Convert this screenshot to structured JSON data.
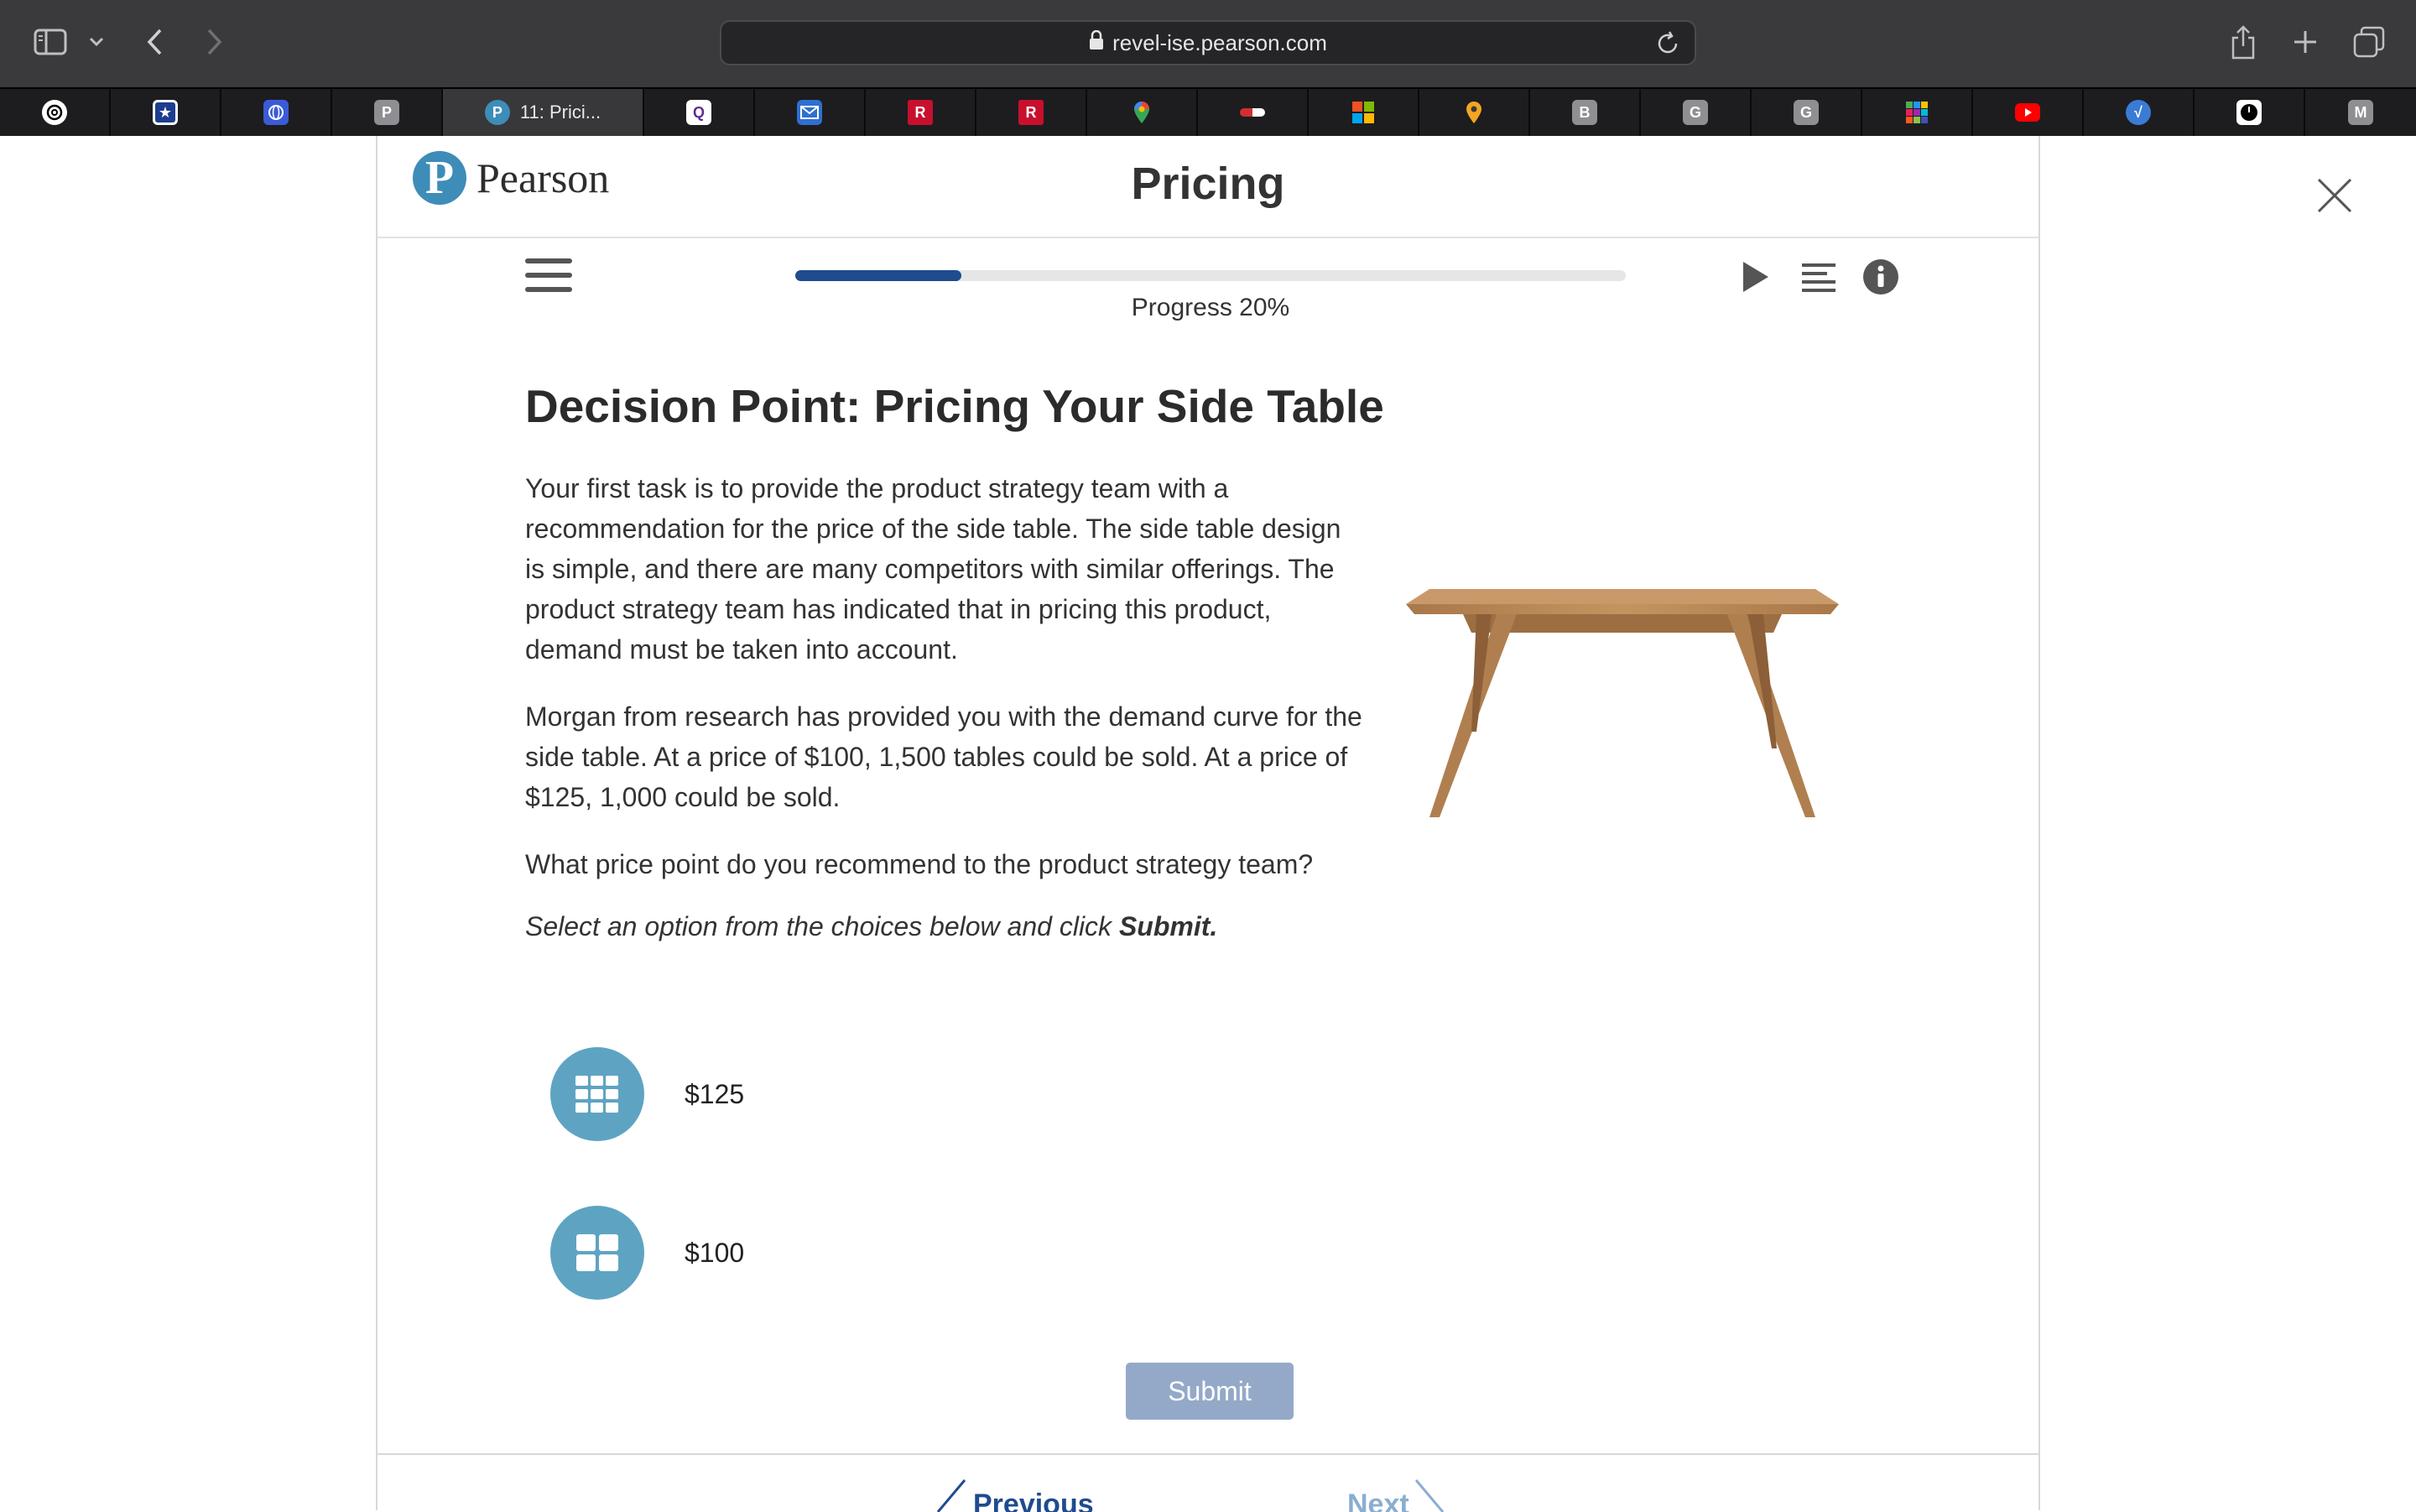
{
  "browser": {
    "url": "revel-ise.pearson.com",
    "tabs": [
      {
        "label": "",
        "icon": "openai-icon"
      },
      {
        "label": "",
        "icon": "star-badge-icon"
      },
      {
        "label": "",
        "icon": "globe-badge-icon"
      },
      {
        "label": "",
        "icon": "p-letter-icon",
        "letter": "P"
      },
      {
        "label": "11: Prici...",
        "icon": "pearson-icon",
        "active": true
      },
      {
        "label": "",
        "icon": "q-letter-icon",
        "letter": "Q"
      },
      {
        "label": "",
        "icon": "mail-icon"
      },
      {
        "label": "",
        "icon": "r-letter-icon",
        "letter": "R"
      },
      {
        "label": "",
        "icon": "r-letter-icon",
        "letter": "R"
      },
      {
        "label": "",
        "icon": "maps-pin-icon"
      },
      {
        "label": "",
        "icon": "pill-icon"
      },
      {
        "label": "",
        "icon": "microsoft-icon"
      },
      {
        "label": "",
        "icon": "location-icon"
      },
      {
        "label": "",
        "icon": "b-letter-icon",
        "letter": "B"
      },
      {
        "label": "",
        "icon": "g-letter-icon",
        "letter": "G"
      },
      {
        "label": "",
        "icon": "g-letter-icon",
        "letter": "G"
      },
      {
        "label": "",
        "icon": "grid-app-icon"
      },
      {
        "label": "",
        "icon": "youtube-icon"
      },
      {
        "label": "",
        "icon": "sqrt-icon"
      },
      {
        "label": "",
        "icon": "clock-icon"
      },
      {
        "label": "",
        "icon": "m-letter-icon",
        "letter": "M"
      }
    ]
  },
  "header": {
    "logo_text": "Pearson",
    "logo_letter": "P",
    "title": "Pricing"
  },
  "progress": {
    "value_percent": 20,
    "label": "Progress 20%"
  },
  "content": {
    "heading": "Decision Point: Pricing Your Side Table",
    "para1": "Your first task is to provide the product strategy team with a recommendation for the price of the side table. The side table design is simple, and there are many competitors with similar offerings. The product strategy team has indicated that in pricing this product, demand must be taken into account.",
    "para2": "Morgan from research has provided you with the demand curve for the side table. At a price of $100, 1,500 tables could be sold. At a price of $125, 1,000 could be sold.",
    "para3": "What price point do you recommend to the product strategy team?",
    "instruction_prefix": "Select an option from the choices below and click ",
    "instruction_bold": "Submit."
  },
  "options": [
    {
      "label": "$125",
      "icon": "grid-9-icon"
    },
    {
      "label": "$100",
      "icon": "grid-4-icon"
    }
  ],
  "submit_label": "Submit",
  "nav": {
    "previous_label": "Previous",
    "next_label": "Next"
  },
  "colors": {
    "accent": "#1f4b8f",
    "option_circle": "#5ea4c2",
    "submit_disabled": "#94a9c8",
    "logo": "#3e8cb8"
  }
}
